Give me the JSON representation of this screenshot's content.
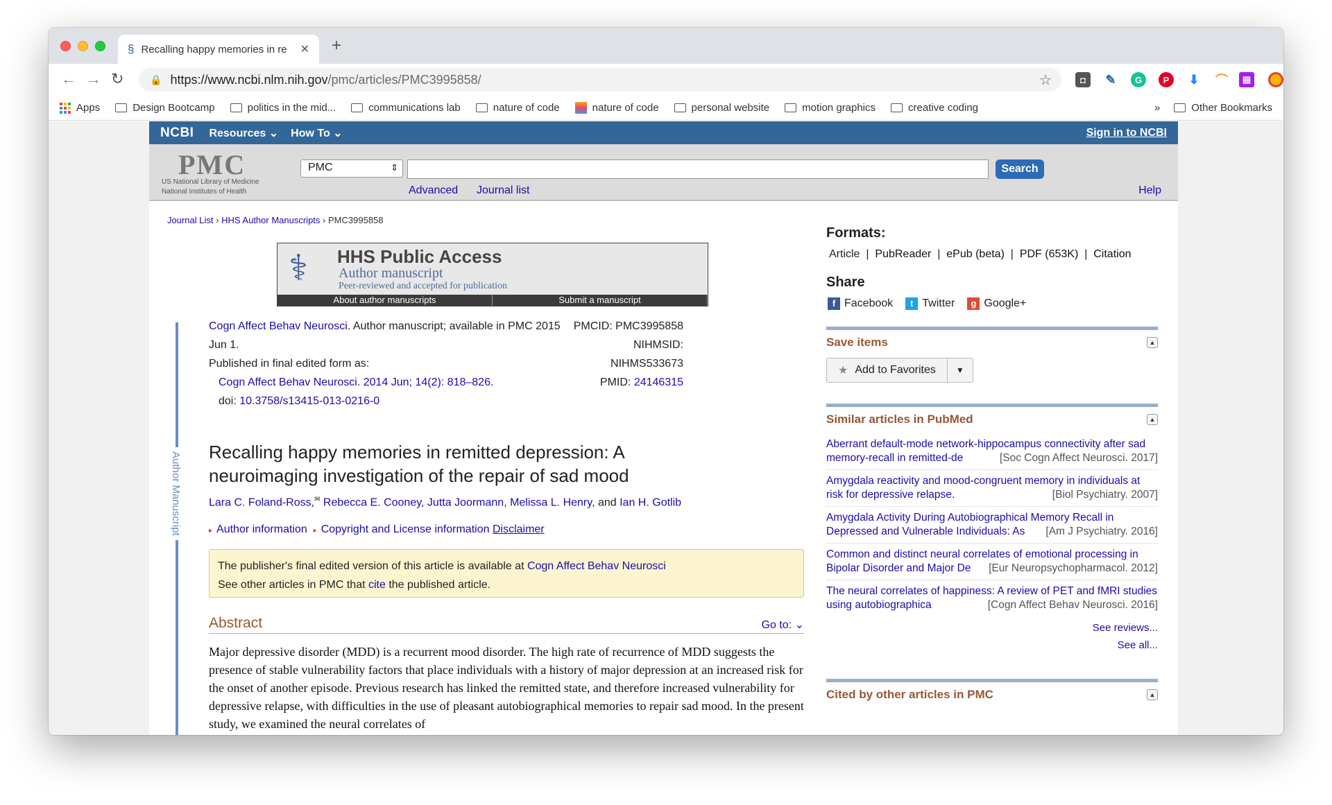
{
  "browser": {
    "tab_title": "Recalling happy memories in re",
    "url_host": "https://www.ncbi.nlm.nih.gov",
    "url_path": "/pmc/articles/PMC3995858/",
    "bookmarks": [
      "Apps",
      "Design Bootcamp",
      "politics in the mid...",
      "communications lab",
      "nature of code",
      "nature of code",
      "personal website",
      "motion graphics",
      "creative coding"
    ],
    "overflow": "»",
    "other_bookmarks": "Other Bookmarks"
  },
  "ncbi": {
    "logo": "NCBI",
    "resources": "Resources",
    "howto": "How To",
    "signin": "Sign in to NCBI"
  },
  "search": {
    "logo": "PMC",
    "nlm_line1": "US National Library of Medicine",
    "nlm_line2": "National Institutes of Health",
    "db": "PMC",
    "button": "Search",
    "advanced": "Advanced",
    "journal_list": "Journal list",
    "help": "Help"
  },
  "breadcrumb": {
    "journal_list": "Journal List",
    "hhs": "HHS Author Manuscripts",
    "sep": "›",
    "current": "PMC3995858"
  },
  "hhs": {
    "title": "HHS Public Access",
    "sub": "Author manuscript",
    "note": "Peer-reviewed and accepted for publication",
    "about": "About author manuscripts",
    "submit": "Submit a manuscript"
  },
  "side_label": "Author Manuscript",
  "citation": {
    "journal": "Cogn Affect Behav Neurosci",
    "status": ". Author manuscript; available in PMC 2015",
    "date": "Jun 1.",
    "published": "Published in final edited form as:",
    "final": "Cogn Affect Behav Neurosci. 2014 Jun; 14(2): 818–826.",
    "doi_label": "doi: ",
    "doi": "10.3758/s13415-013-0216-0",
    "pmcid": "PMCID: PMC3995858",
    "nihmsid": "NIHMSID: NIHMS533673",
    "pmid_label": "PMID: ",
    "pmid": "24146315"
  },
  "article": {
    "title": "Recalling happy memories in remitted depression: A neuroimaging investigation of the repair of sad mood",
    "authors": [
      "Lara C. Foland-Ross,",
      "Rebecca E. Cooney",
      "Jutta Joormann",
      "Melissa L. Henry",
      "Ian H. Gotlib"
    ],
    "and": "and",
    "author_info": "Author information",
    "copyright": "Copyright and License information",
    "disclaimer": "Disclaimer"
  },
  "notice": {
    "line1": "The publisher's final edited version of this article is available at ",
    "line1_link": "Cogn Affect Behav Neurosci",
    "line2a": "See other articles in PMC that ",
    "cite": "cite",
    "line2b": " the published article."
  },
  "abstract": {
    "heading": "Abstract",
    "goto": "Go to:",
    "text": "Major depressive disorder (MDD) is a recurrent mood disorder. The high rate of recurrence of MDD suggests the presence of stable vulnerability factors that place individuals with a history of major depression at an increased risk for the onset of another episode. Previous research has linked the remitted state, and therefore increased vulnerability for depressive relapse, with difficulties in the use of pleasant autobiographical memories to repair sad mood. In the present study, we examined the neural correlates of"
  },
  "right": {
    "formats_h": "Formats:",
    "formats": [
      "Article",
      "PubReader",
      "ePub (beta)",
      "PDF (653K)",
      "Citation"
    ],
    "share_h": "Share",
    "facebook": "Facebook",
    "twitter": "Twitter",
    "google": "Google+",
    "save_h": "Save items",
    "add_fav": "Add to Favorites",
    "similar_h": "Similar articles in PubMed",
    "similar": [
      {
        "title": "Aberrant default-mode network-hippocampus connectivity after sad memory-recall in remitted-de",
        "src": "[Soc Cogn Affect Neurosci. 2017]"
      },
      {
        "title": "Amygdala reactivity and mood-congruent memory in individuals at risk for depressive relapse.",
        "src": "[Biol Psychiatry. 2007]"
      },
      {
        "title": "Amygdala Activity During Autobiographical Memory Recall in Depressed and Vulnerable Individuals: As",
        "src": "[Am J Psychiatry. 2016]"
      },
      {
        "title": "Common and distinct neural correlates of emotional processing in Bipolar Disorder and Major De",
        "src": "[Eur Neuropsychopharmacol. 2012]"
      },
      {
        "title": "The neural correlates of happiness: A review of PET and fMRI studies using autobiographica",
        "src": "[Cogn Affect Behav Neurosci. 2016]"
      }
    ],
    "see_reviews": "See reviews...",
    "see_all": "See all...",
    "cited_h": "Cited by other articles in PMC"
  }
}
